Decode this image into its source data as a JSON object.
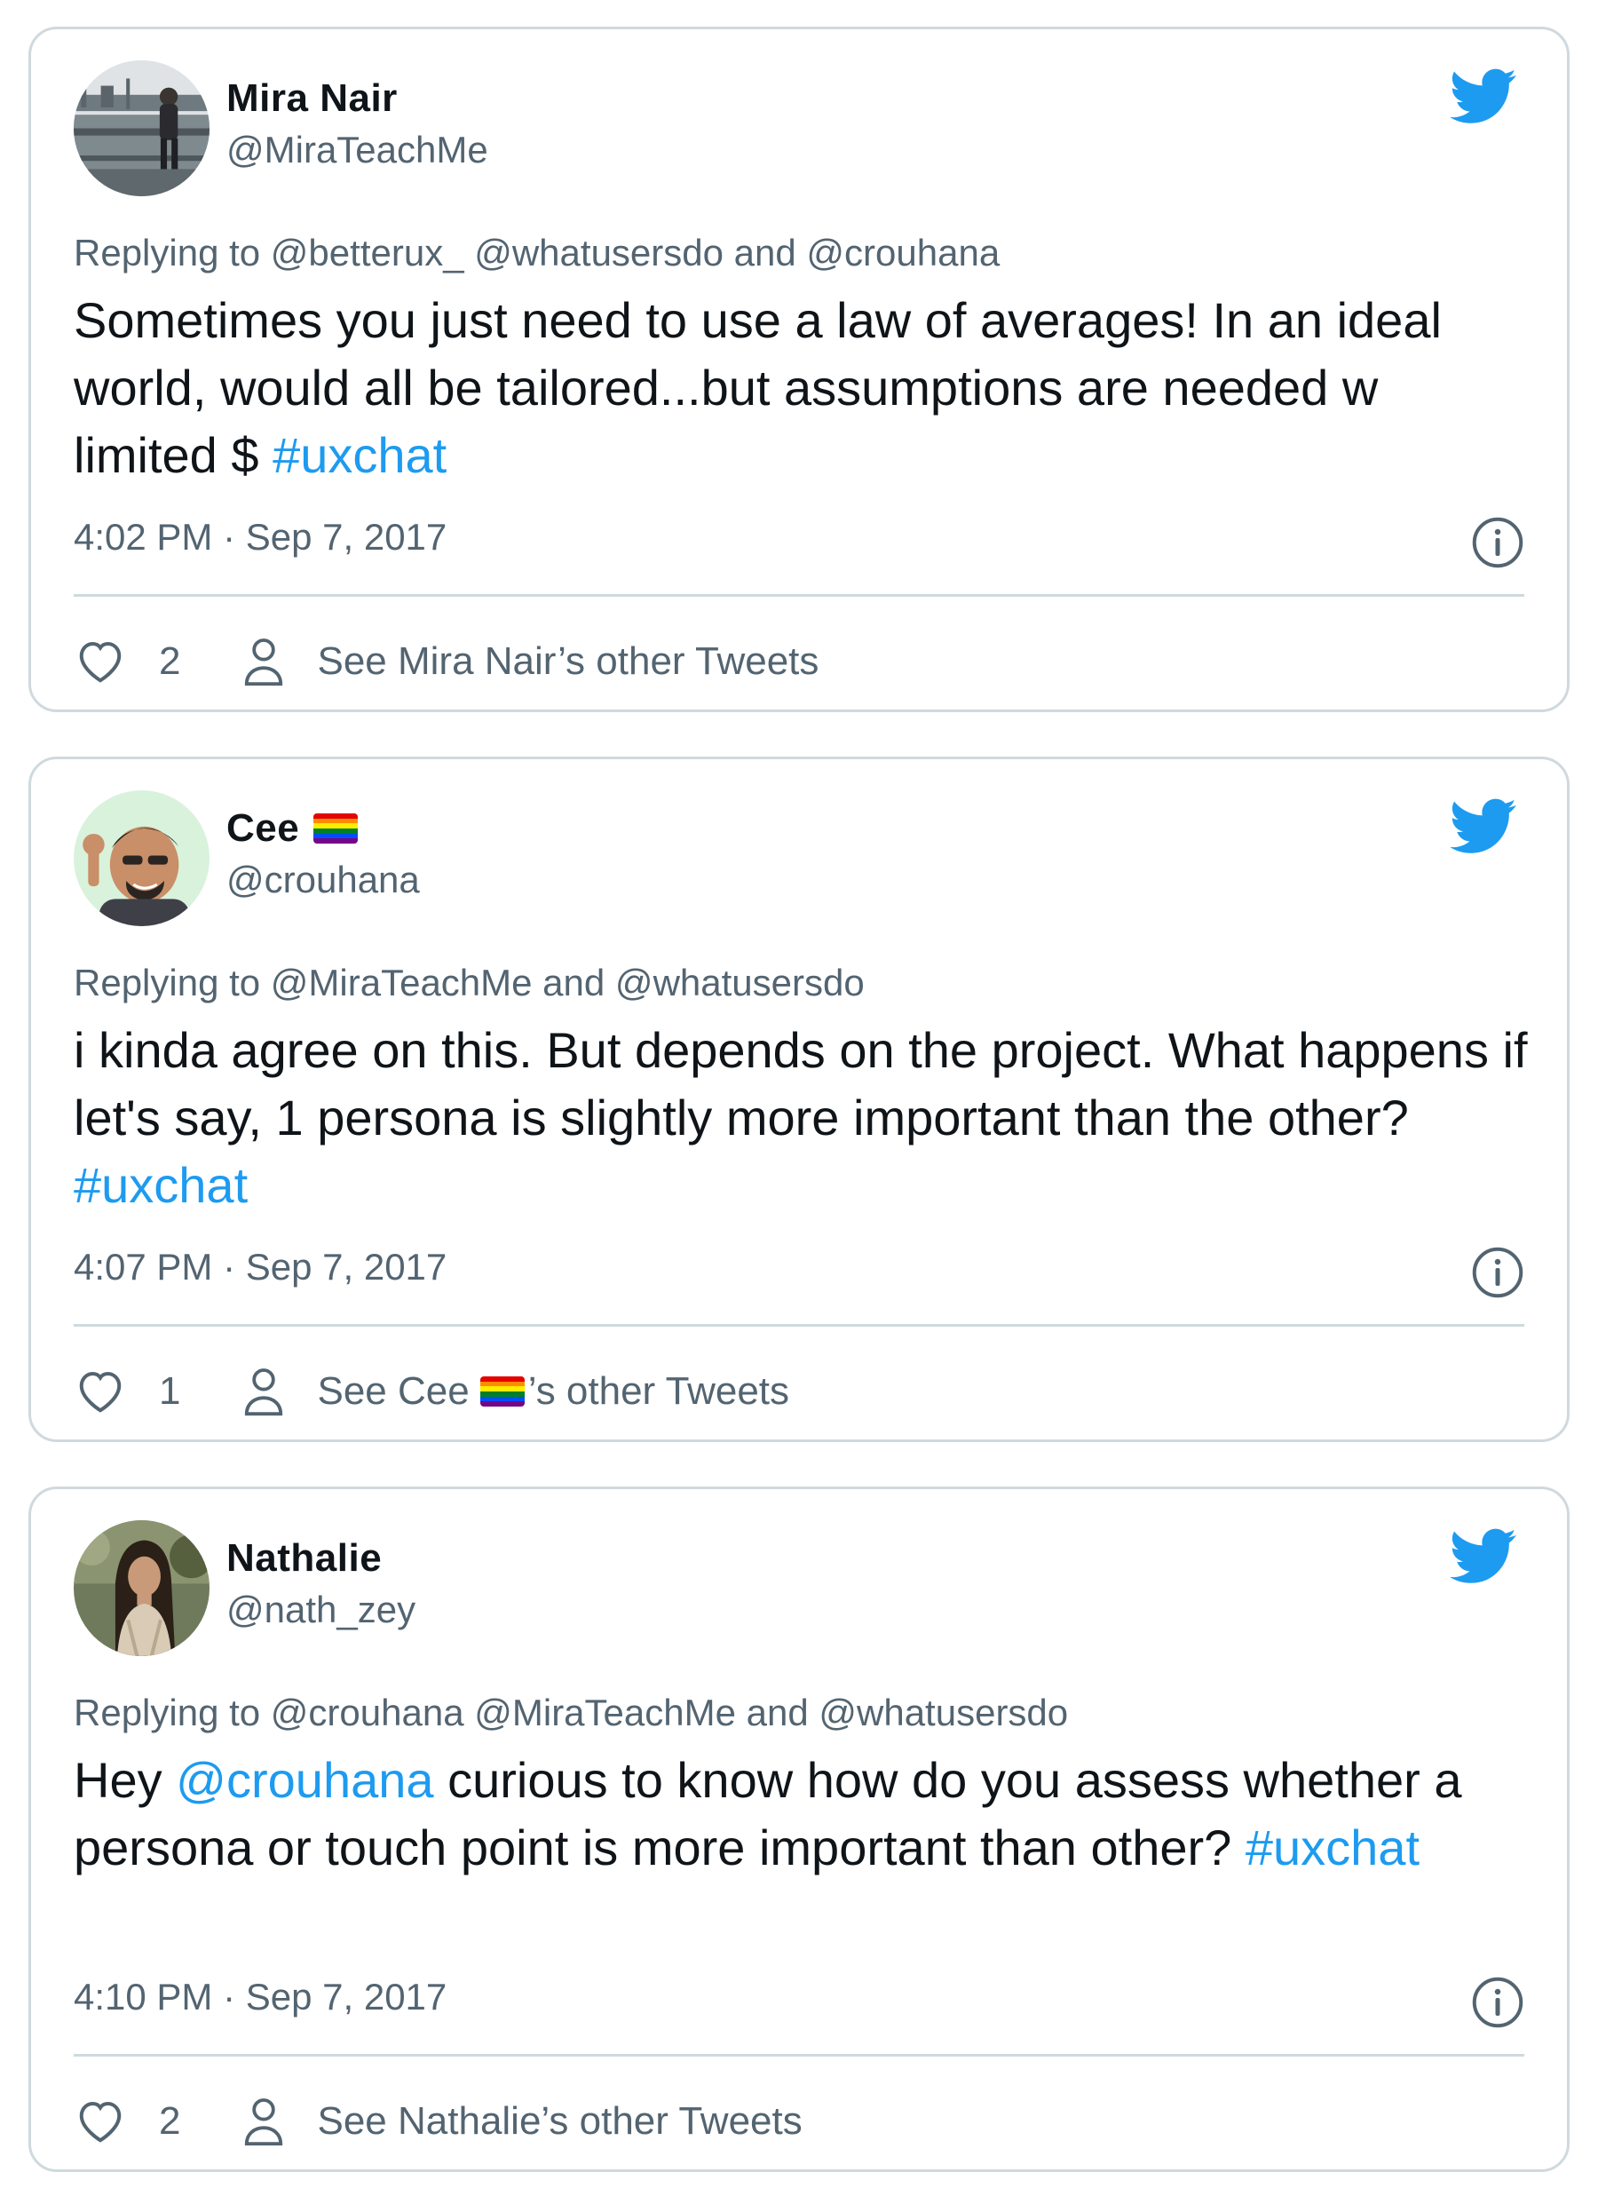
{
  "colors": {
    "accent": "#1d9bf0",
    "secondary_text": "#536471",
    "border": "#cfd9de"
  },
  "tweets": [
    {
      "name": "Mira Nair",
      "handle": "@MiraTeachMe",
      "replying_prefix": "Replying to ",
      "replying_rest": "@betterux_ @whatusersdo and @crouhana",
      "body_pre": "Sometimes you just need to use a law of averages! In an ideal world, would all be tailored...but assumptions are needed w limited $ ",
      "body_hashtag": "#uxchat",
      "time": "4:02 PM · Sep 7, 2017",
      "likes": "2",
      "see_other_pre": "See Mira Nair’s other Tweets",
      "see_other_post": "",
      "name_flag": false,
      "avatar": "photo-person-city"
    },
    {
      "name": "Cee",
      "handle": "@crouhana",
      "replying_prefix": "Replying to ",
      "replying_rest": "@MiraTeachMe and @whatusersdo",
      "body_pre": "i kinda agree on this. But depends on the project. What happens if let's say, 1 persona is slightly more important than the other? ",
      "body_hashtag": "#uxchat",
      "time": "4:07 PM · Sep 7, 2017",
      "likes": "1",
      "see_other_pre": "See Cee",
      "see_other_post": "’s other Tweets",
      "name_flag": true,
      "avatar": "cartoon-person-waving"
    },
    {
      "name": "Nathalie",
      "handle": "@nath_zey",
      "replying_prefix": "Replying to ",
      "replying_rest": "@crouhana @MiraTeachMe and @whatusersdo",
      "body_pre": "Hey ",
      "body_mention": "@crouhana",
      "body_mid": " curious to know how do you assess whether a persona or touch point is more important than other? ",
      "body_hashtag": "#uxchat",
      "time": "4:10 PM · Sep 7, 2017",
      "likes": "2",
      "see_other_pre": "See Nathalie’s other Tweets",
      "see_other_post": "",
      "name_flag": false,
      "avatar": "photo-person-outdoor"
    }
  ],
  "icons": {
    "brand": "twitter-bird-icon",
    "info": "info-icon",
    "like": "heart-outline-icon",
    "profile": "person-outline-icon",
    "flag": "rainbow-flag-emoji"
  }
}
